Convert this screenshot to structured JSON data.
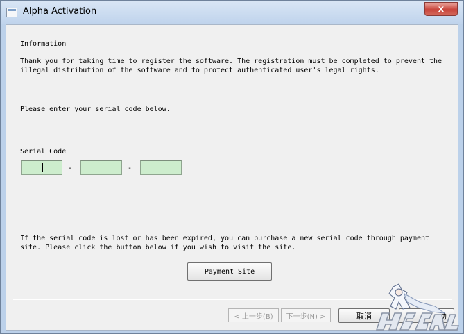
{
  "window": {
    "title": "Alpha Activation",
    "close_label": "x"
  },
  "info": {
    "heading": "Information",
    "text": "Thank you for taking time to register the software. The registration must be completed to prevent the illegal distribution of the software and to protect authenticated user's legal rights.",
    "prompt": "Please enter your serial code below."
  },
  "serial": {
    "label": "Serial Code",
    "separator": "-",
    "fields": [
      "",
      "",
      ""
    ]
  },
  "help": {
    "text": "If the serial code is lost or has been expired, you can purchase a new serial code through payment site. Please click the button below if you wish to visit the site.",
    "payment_button": "Payment Site"
  },
  "wizard": {
    "back_label": "< 上一步(B)",
    "next_label": "下一步(N) >",
    "cancel_label": "取消",
    "finish_label": "助"
  },
  "colors": {
    "serial_field_bg": "#cdedcd",
    "close_button": "#c8443b",
    "frame": "#bcd1ea"
  }
}
